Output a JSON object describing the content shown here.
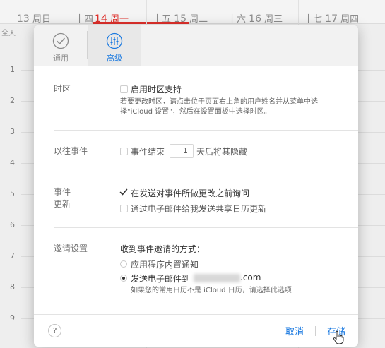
{
  "calendar": {
    "days": [
      {
        "lunar": "",
        "num": "13",
        "weekday": "周日"
      },
      {
        "lunar": "十四",
        "num": "14",
        "weekday": "周一"
      },
      {
        "lunar": "十五",
        "num": "15",
        "weekday": "周二"
      },
      {
        "lunar": "十六",
        "num": "16",
        "weekday": "周三"
      },
      {
        "lunar": "十七",
        "num": "17",
        "weekday": "周四"
      }
    ],
    "allday_label": "全天",
    "hours": [
      "1",
      "2",
      "3",
      "4",
      "5",
      "6",
      "7",
      "8",
      "9"
    ]
  },
  "tabs": [
    {
      "label": "通用",
      "icon": "checkmark-circle-icon"
    },
    {
      "label": "高级",
      "icon": "sliders-icon"
    }
  ],
  "timezone": {
    "label": "时区",
    "option": "启用时区支持",
    "note_line1": "若要更改时区，请点击位于页面右上角的用户姓名并从菜单中选",
    "note_line2": "择\"iCloud 设置\"，然后在设置面板中选择时区。"
  },
  "past_events": {
    "label": "以往事件",
    "prefix": "事件结束",
    "days_value": "1",
    "suffix": "天后将其隐藏"
  },
  "event_updates": {
    "label_line1": "事件",
    "label_line2": "更新",
    "option1": "在发送对事件所做更改之前询问",
    "option2": "通过电子邮件给我发送共享日历更新"
  },
  "invitations": {
    "label": "邀请设置",
    "heading": "收到事件邀请的方式：",
    "option_app": "应用程序内置通知",
    "option_email_prefix": "发送电子邮件到",
    "email_domain": ".com",
    "note": "如果您的常用日历不是 iCloud 日历，请选择此选项"
  },
  "footer": {
    "help": "?",
    "cancel": "取消",
    "save": "存储"
  },
  "colors": {
    "accent": "#1a79e0",
    "today": "#e0302b"
  }
}
